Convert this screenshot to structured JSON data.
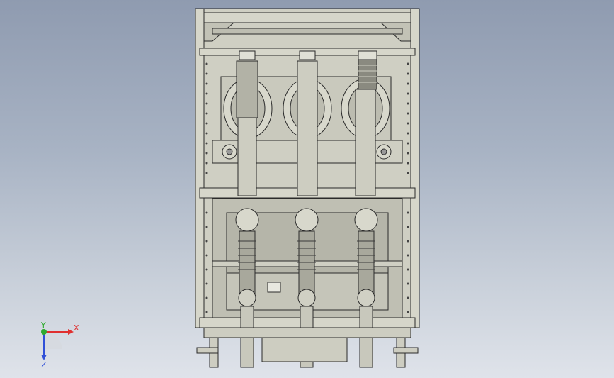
{
  "triad": {
    "x_label": "X",
    "y_label": "Y",
    "z_label": "Z",
    "x_color": "#e03030",
    "y_color": "#2faa2f",
    "z_color": "#3050d8"
  },
  "model": {
    "frame_color": "#d8d8cc",
    "line_color": "#2a2a2a",
    "body_color": "#c8c8bc",
    "shade_color": "#9a9a90",
    "phase_count": 3
  }
}
